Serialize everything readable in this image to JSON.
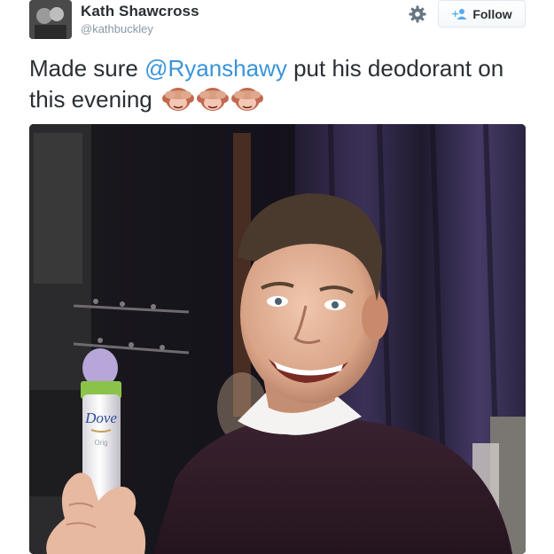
{
  "tweet": {
    "author_name": "Kath Shawcross",
    "author_handle": "@kathbuckley",
    "follow_label": "Follow",
    "text_before": "Made sure ",
    "mention": "@Ryanshawy",
    "text_after": " put his deodorant on this evening",
    "emoji_count": 3,
    "emoji_name": "see-no-evil-monkey"
  },
  "photo": {
    "product_brand": "Dove",
    "product_variant": "Orig"
  },
  "icons": {
    "settings": "gear-icon",
    "follow": "add-user-icon"
  },
  "colors": {
    "mention": "#3b94d9",
    "handle": "#8899a6",
    "text": "#292f33"
  }
}
